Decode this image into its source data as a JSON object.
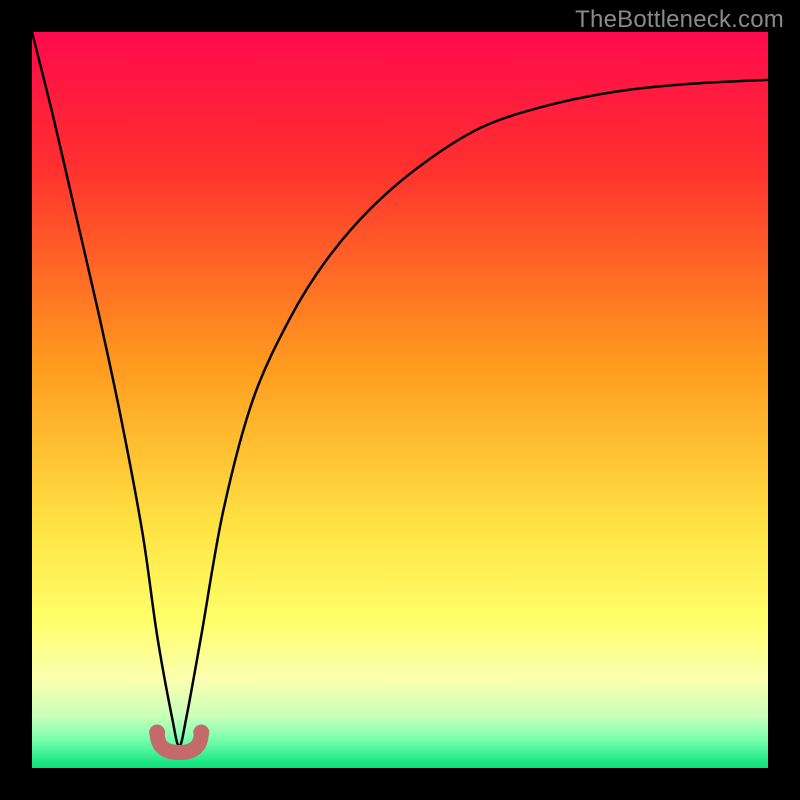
{
  "watermark": {
    "text": "TheBottleneck.com"
  },
  "colors": {
    "frame": "#000000",
    "curve": "#000000",
    "accent": "#c46a6a",
    "gradient_stops": [
      {
        "pct": 0,
        "color": "#ff0a4d"
      },
      {
        "pct": 18,
        "color": "#ff2f2f"
      },
      {
        "pct": 45,
        "color": "#ff9a1e"
      },
      {
        "pct": 68,
        "color": "#ffe545"
      },
      {
        "pct": 80,
        "color": "#ffff6a"
      },
      {
        "pct": 88,
        "color": "#fbffb0"
      },
      {
        "pct": 93,
        "color": "#c8ffba"
      },
      {
        "pct": 96,
        "color": "#7dffb0"
      },
      {
        "pct": 100,
        "color": "#06e27a"
      }
    ]
  },
  "chart_data": {
    "type": "line",
    "title": "",
    "xlabel": "",
    "ylabel": "",
    "xlim": [
      0,
      100
    ],
    "ylim": [
      0,
      100
    ],
    "grid": false,
    "optimum_x": 20,
    "accent_segment": {
      "x_start": 17,
      "x_end": 23,
      "y": 4
    },
    "series": [
      {
        "name": "bottleneck-curve",
        "x": [
          0,
          3,
          6,
          9,
          12,
          15,
          17,
          19,
          20,
          21,
          23,
          26,
          30,
          35,
          40,
          46,
          53,
          61,
          70,
          80,
          90,
          100
        ],
        "y": [
          100,
          88,
          75,
          62,
          48,
          32,
          18,
          7,
          3,
          7,
          18,
          35,
          50,
          61,
          69,
          76,
          82,
          87,
          90,
          92,
          93,
          93.5
        ]
      }
    ]
  }
}
